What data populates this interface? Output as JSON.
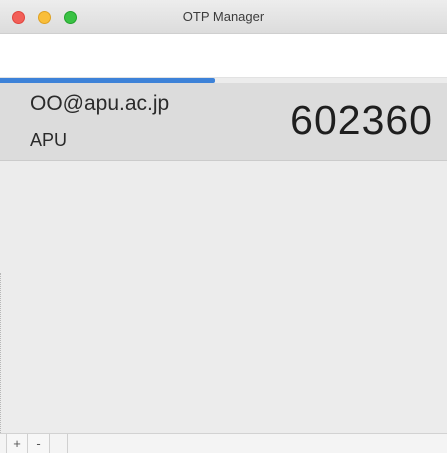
{
  "window": {
    "title": "OTP Manager"
  },
  "progress": {
    "fraction": 0.48,
    "color": "#3d82d8"
  },
  "entries": [
    {
      "account": "OO@apu.ac.jp",
      "issuer": "APU",
      "code": "602360"
    }
  ],
  "toolbar": {
    "add_label": "+",
    "remove_label": "-"
  }
}
